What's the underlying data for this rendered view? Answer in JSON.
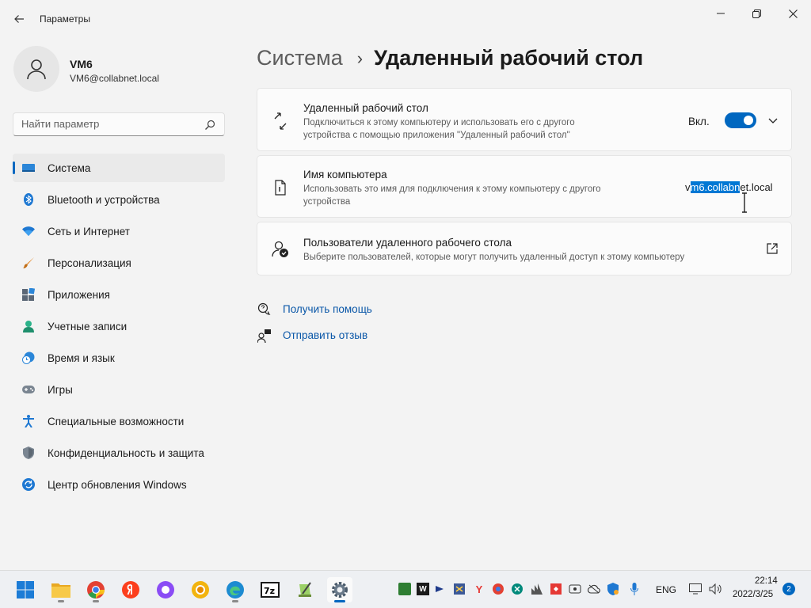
{
  "window": {
    "title": "Параметры",
    "back_icon": "back-arrow-icon",
    "controls": [
      "minimize-icon",
      "maximize-icon",
      "close-icon"
    ]
  },
  "profile": {
    "name": "VM6",
    "email": "VM6@collabnet.local"
  },
  "search": {
    "placeholder": "Найти параметр"
  },
  "sidebar": {
    "items": [
      {
        "label": "Система",
        "icon": "system-icon",
        "active": true
      },
      {
        "label": "Bluetooth и устройства",
        "icon": "bluetooth-icon"
      },
      {
        "label": "Сеть и Интернет",
        "icon": "network-icon"
      },
      {
        "label": "Персонализация",
        "icon": "brush-icon"
      },
      {
        "label": "Приложения",
        "icon": "apps-icon"
      },
      {
        "label": "Учетные записи",
        "icon": "accounts-icon"
      },
      {
        "label": "Время и язык",
        "icon": "time-language-icon"
      },
      {
        "label": "Игры",
        "icon": "gamepad-icon"
      },
      {
        "label": "Специальные возможности",
        "icon": "accessibility-icon"
      },
      {
        "label": "Конфиденциальность и защита",
        "icon": "shield-icon"
      },
      {
        "label": "Центр обновления Windows",
        "icon": "update-icon"
      }
    ]
  },
  "header": {
    "parent": "Система",
    "separator": "›",
    "current": "Удаленный рабочий стол"
  },
  "cards": {
    "remote_desktop": {
      "title": "Удаленный рабочий стол",
      "desc_line1": "Подключиться к этому компьютеру и использовать его с другого",
      "desc_line2": "устройства с помощью приложения \"Удаленный рабочий стол\"",
      "toggle_label": "Вкл.",
      "toggle_on": true
    },
    "pc_name": {
      "title": "Имя компьютера",
      "desc_line1": "Использовать это имя для подключения к этому компьютеру с другого",
      "desc_line2": "устройства",
      "value_pre": "v",
      "value_selected": "m6.collabn",
      "value_post": "et.local"
    },
    "remote_users": {
      "title": "Пользователи удаленного рабочего стола",
      "desc": "Выберите пользователей, которые могут получить удаленный доступ к этому компьютеру"
    }
  },
  "links": {
    "help": "Получить помощь",
    "feedback": "Отправить отзыв"
  },
  "taskbar": {
    "language": "ENG",
    "time": "22:14",
    "date": "2022/3/25",
    "notifications": "2",
    "apps": [
      "windows-start-icon",
      "file-explorer-icon",
      "chrome-icon",
      "yandex-icon",
      "alice-icon",
      "chrome-canary-icon",
      "edge-icon",
      "7zip-icon",
      "notepad-plus-icon",
      "settings-icon"
    ]
  },
  "colors": {
    "accent": "#0067c0",
    "background": "#f3f3f3",
    "card": "#fbfbfb",
    "link": "#0a57a8"
  }
}
